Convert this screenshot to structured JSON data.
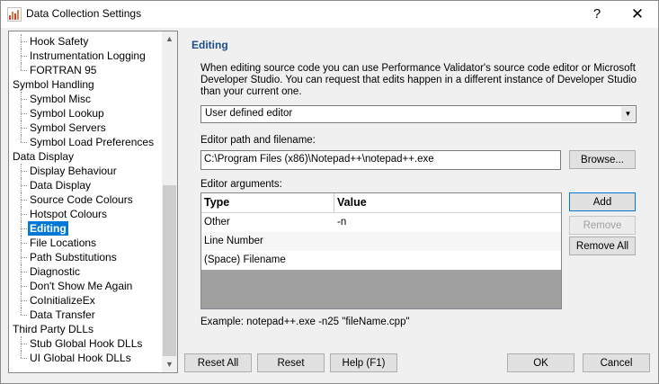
{
  "window": {
    "title": "Data Collection Settings",
    "help_glyph": "?",
    "close_glyph": "✕"
  },
  "tree": {
    "rows": [
      {
        "label": "Hook Safety",
        "level": 1
      },
      {
        "label": "Instrumentation Logging",
        "level": 1
      },
      {
        "label": "FORTRAN 95",
        "level": 1,
        "last": true
      },
      {
        "label": "Symbol Handling",
        "level": 0
      },
      {
        "label": "Symbol Misc",
        "level": 1
      },
      {
        "label": "Symbol Lookup",
        "level": 1
      },
      {
        "label": "Symbol Servers",
        "level": 1
      },
      {
        "label": "Symbol Load Preferences",
        "level": 1,
        "last": true
      },
      {
        "label": "Data Display",
        "level": 0
      },
      {
        "label": "Display Behaviour",
        "level": 1
      },
      {
        "label": "Data Display",
        "level": 1
      },
      {
        "label": "Source Code Colours",
        "level": 1
      },
      {
        "label": "Hotspot Colours",
        "level": 1
      },
      {
        "label": "Editing",
        "level": 1,
        "selected": true
      },
      {
        "label": "File Locations",
        "level": 1
      },
      {
        "label": "Path Substitutions",
        "level": 1
      },
      {
        "label": "Diagnostic",
        "level": 1
      },
      {
        "label": "Don't Show Me Again",
        "level": 1
      },
      {
        "label": "CoInitializeEx",
        "level": 1
      },
      {
        "label": "Data Transfer",
        "level": 1,
        "last": true
      },
      {
        "label": "Third Party DLLs",
        "level": 0
      },
      {
        "label": "Stub Global Hook DLLs",
        "level": 1
      },
      {
        "label": "UI Global Hook DLLs",
        "level": 1,
        "last": true
      }
    ],
    "scroll_up_glyph": "▲",
    "scroll_down_glyph": "▼"
  },
  "editing": {
    "title": "Editing",
    "description": "When editing source code you can use Performance Validator's source code editor or Microsoft Developer Studio. You can request that edits happen in a different instance of Developer Studio than your current one.",
    "editor_select": {
      "value": "User defined editor",
      "arrow_glyph": "▼"
    },
    "path_label": "Editor path and filename:",
    "path_value": "C:\\Program Files (x86)\\Notepad++\\notepad++.exe",
    "browse_label": "Browse...",
    "args_label": "Editor arguments:",
    "args_columns": {
      "type": "Type",
      "value": "Value"
    },
    "args_rows": [
      {
        "type": "Other",
        "value": "-n"
      },
      {
        "type": "Line Number",
        "value": ""
      },
      {
        "type": "(Space) Filename",
        "value": ""
      }
    ],
    "add_label": "Add",
    "remove_label": "Remove",
    "remove_all_label": "Remove All",
    "example": "Example: notepad++.exe -n25 \"fileName.cpp\""
  },
  "footer": {
    "reset_all": "Reset All",
    "reset": "Reset",
    "help": "Help (F1)",
    "ok": "OK",
    "cancel": "Cancel"
  },
  "colors": {
    "selection": "#0078d7",
    "section_title": "#1a4f8a"
  }
}
